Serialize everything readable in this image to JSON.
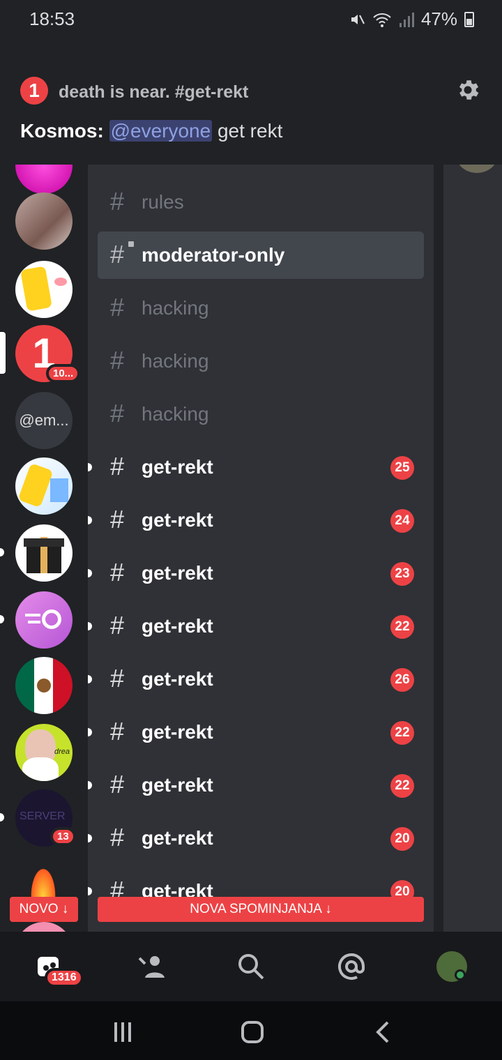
{
  "status_bar": {
    "time": "18:53",
    "battery": "47%"
  },
  "notification": {
    "badge": "1",
    "title": "death is near. #get-rekt",
    "author": "Kosmos:",
    "mention": "@everyone",
    "text": "get rekt"
  },
  "servers": {
    "selected_badge": "10...",
    "dm_label": "@em...",
    "server_text": "SERVER",
    "server_badge": "13",
    "mexico_text": "drea"
  },
  "channels": [
    {
      "name": "rules",
      "state": "normal"
    },
    {
      "name": "moderator-only",
      "state": "selected"
    },
    {
      "name": "hacking",
      "state": "normal"
    },
    {
      "name": "hacking",
      "state": "normal"
    },
    {
      "name": "hacking",
      "state": "normal"
    },
    {
      "name": "get-rekt",
      "state": "unread",
      "mentions": "25"
    },
    {
      "name": "get-rekt",
      "state": "unread",
      "mentions": "24"
    },
    {
      "name": "get-rekt",
      "state": "unread",
      "mentions": "23"
    },
    {
      "name": "get-rekt",
      "state": "unread",
      "mentions": "22"
    },
    {
      "name": "get-rekt",
      "state": "unread",
      "mentions": "26"
    },
    {
      "name": "get-rekt",
      "state": "unread",
      "mentions": "22"
    },
    {
      "name": "get-rekt",
      "state": "unread",
      "mentions": "22"
    },
    {
      "name": "get-rekt",
      "state": "unread",
      "mentions": "20"
    },
    {
      "name": "get-rekt",
      "state": "unread",
      "mentions": "20"
    }
  ],
  "banners": {
    "novo": "NOVO ↓",
    "nova": "NOVA SPOMINJANJA ↓"
  },
  "tabbar": {
    "home_badge": "1316"
  },
  "colors": {
    "accent": "#ed4245",
    "mention_bg": "#3c4270",
    "mention_fg": "#8ea1e1"
  }
}
